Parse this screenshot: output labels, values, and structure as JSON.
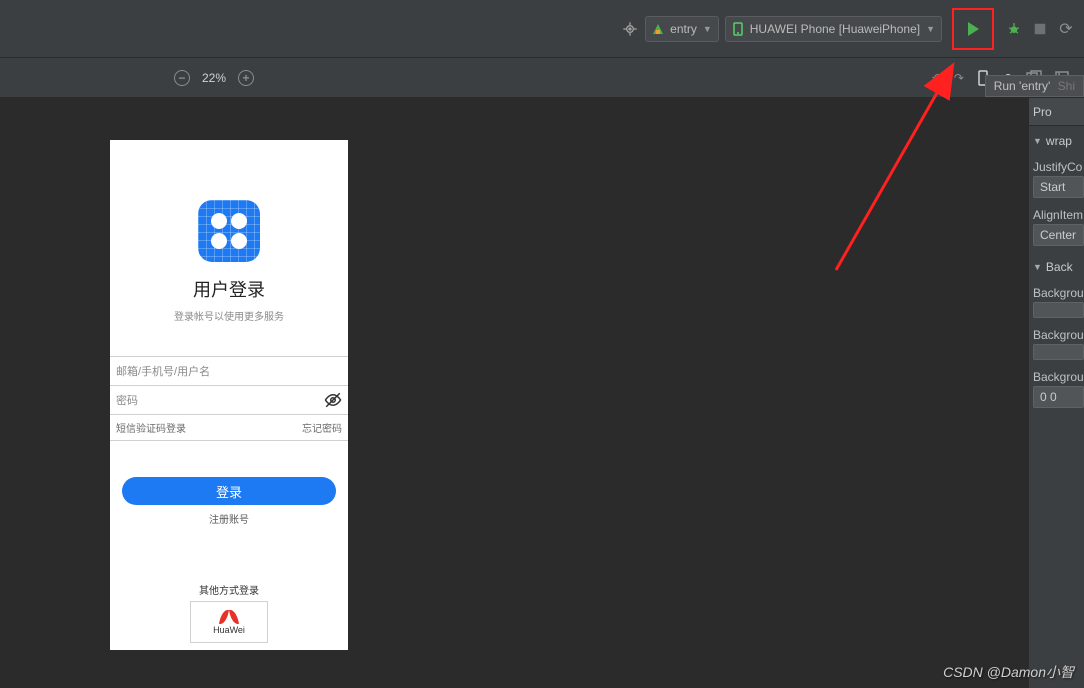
{
  "toolbar": {
    "entry_combo": "entry",
    "device_combo": "HUAWEI Phone [HuaweiPhone]",
    "tooltip_main": "Run 'entry'",
    "tooltip_ghost": "Shi"
  },
  "zoombar": {
    "zoom_pct": "22%"
  },
  "props_panel": {
    "header": "Pro",
    "section1": "wrap",
    "justify_label": "JustifyCo",
    "justify_value": "Start",
    "align_label": "AlignItem",
    "align_value": "Center",
    "section2": "Back",
    "bg1_label": "Backgrou",
    "bg2_label": "Backgrou",
    "bg3_label": "Backgrou",
    "bg3_value": "0 0"
  },
  "phone": {
    "title": "用户登录",
    "subtitle": "登录帐号以使用更多服务",
    "field_user": "邮箱/手机号/用户名",
    "field_pwd": "密码",
    "link_sms": "短信验证码登录",
    "link_forgot": "忘记密码",
    "btn_login": "登录",
    "link_register": "注册账号",
    "other_label": "其他方式登录",
    "huawei_label": "HuaWei"
  },
  "watermark": "CSDN @Damon小智"
}
